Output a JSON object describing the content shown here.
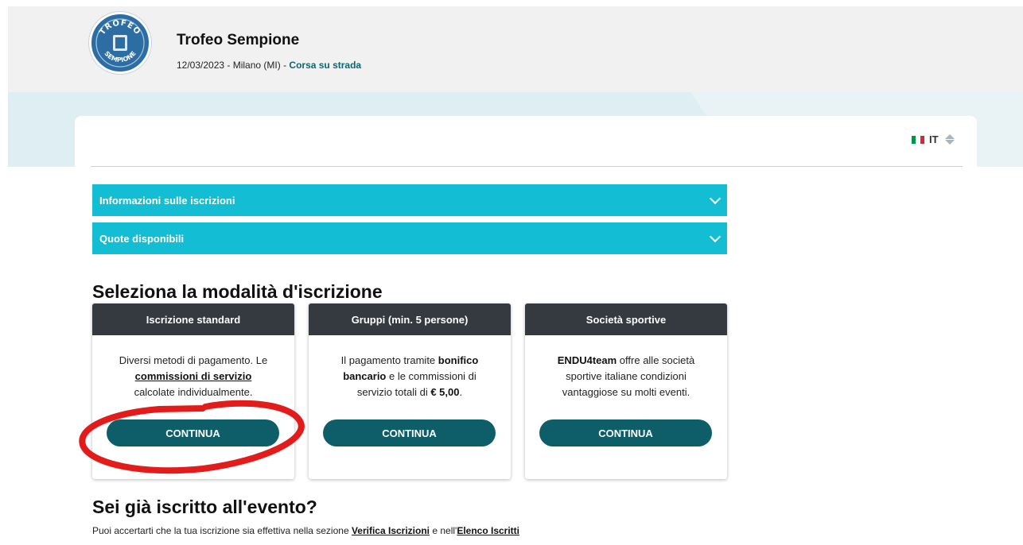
{
  "header": {
    "logo_text_top": "TROFEO",
    "logo_text_bottom": "SEMPIONE",
    "title": "Trofeo Sempione",
    "meta": "12/03/2023 - Milano (MI) - ",
    "category": "Corsa su strada"
  },
  "language": {
    "code": "IT",
    "icon": "italian-flag-icon"
  },
  "accordions": [
    {
      "label": "Informazioni sulle iscrizioni",
      "icon": "chevron-down-icon"
    },
    {
      "label": "Quote disponibili",
      "icon": "chevron-down-icon"
    }
  ],
  "registration": {
    "title": "Seleziona la modalità d'iscrizione",
    "cards": [
      {
        "title": "Iscrizione standard",
        "line1": "Diversi metodi di pagamento. Le",
        "link": "commissioni di servizio",
        "line3": "calcolate individualmente.",
        "button": "CONTINUA"
      },
      {
        "title": "Gruppi (min. 5 persone)",
        "t1": "Il pagamento tramite ",
        "b1": "bonifico",
        "b2": "bancario",
        "t2": " e le commissioni di",
        "t3": "servizio totali di ",
        "b3": "€ 5,00",
        "t4": ".",
        "button": "CONTINUA"
      },
      {
        "title": "Società sportive",
        "b1": "ENDU4team",
        "t1": " offre alle società",
        "t2": "sportive italiane condizioni",
        "t3": "vantaggiose su molti eventi.",
        "button": "CONTINUA"
      }
    ]
  },
  "already": {
    "title": "Sei già iscritto all'evento?",
    "text1": "Puoi accertarti che la tua iscrizione sia effettiva nella sezione ",
    "link1": "Verifica Iscrizioni",
    "text2": " e nell'",
    "link2": "Elenco Iscritti"
  },
  "colors": {
    "accordion": "#13bdd4",
    "card_header": "#343a40",
    "button": "#0e5e69",
    "annotation_marker": "#e21b1b"
  }
}
